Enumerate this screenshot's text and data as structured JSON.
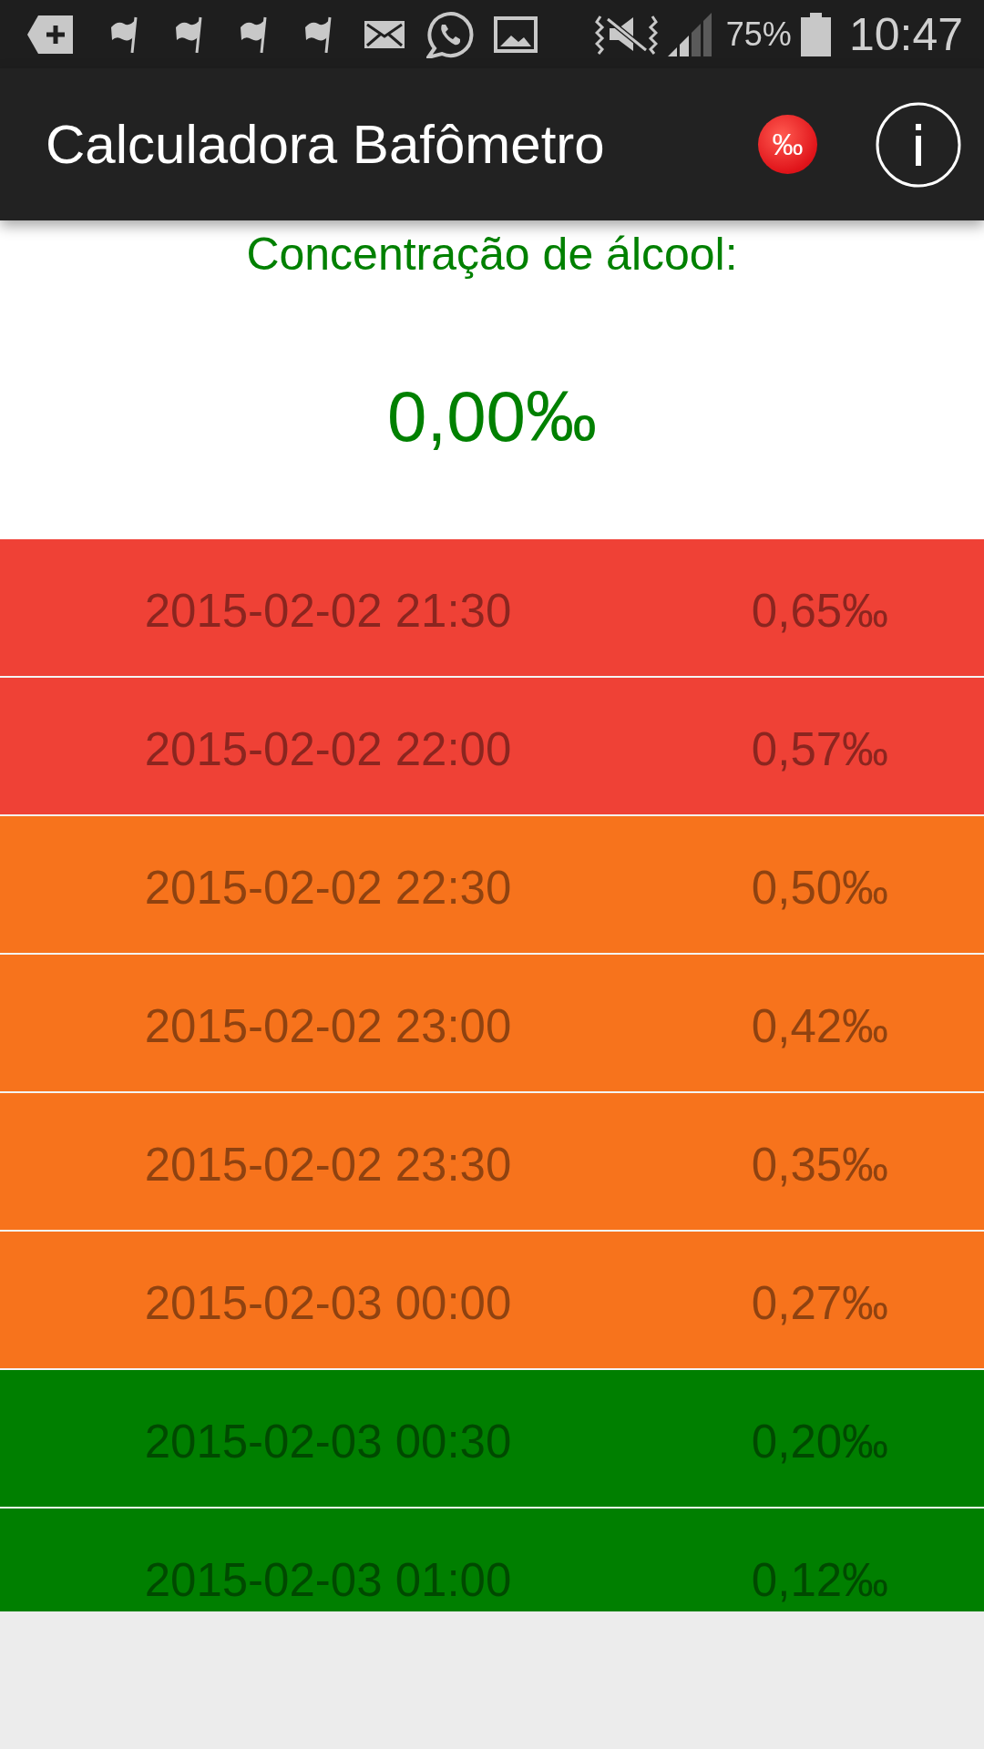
{
  "status_bar": {
    "battery": "75%",
    "time": "10:47"
  },
  "app_bar": {
    "title": "Calculadora Bafômetro",
    "badge": "‰"
  },
  "current": {
    "label": "Concentração de álcool:",
    "value": "0,00‰"
  },
  "readings": [
    {
      "time": "2015-02-02 21:30",
      "value": "0,65‰",
      "color": "#ef4136"
    },
    {
      "time": "2015-02-02 22:00",
      "value": "0,57‰",
      "color": "#ef4136"
    },
    {
      "time": "2015-02-02 22:30",
      "value": "0,50‰",
      "color": "#f7731c"
    },
    {
      "time": "2015-02-02 23:00",
      "value": "0,42‰",
      "color": "#f7731c"
    },
    {
      "time": "2015-02-02 23:30",
      "value": "0,35‰",
      "color": "#f7731c"
    },
    {
      "time": "2015-02-03 00:00",
      "value": "0,27‰",
      "color": "#f7731c"
    },
    {
      "time": "2015-02-03 00:30",
      "value": "0,20‰",
      "color": "#007f00"
    },
    {
      "time": "2015-02-03 01:00",
      "value": "0,12‰",
      "color": "#007f00"
    }
  ]
}
